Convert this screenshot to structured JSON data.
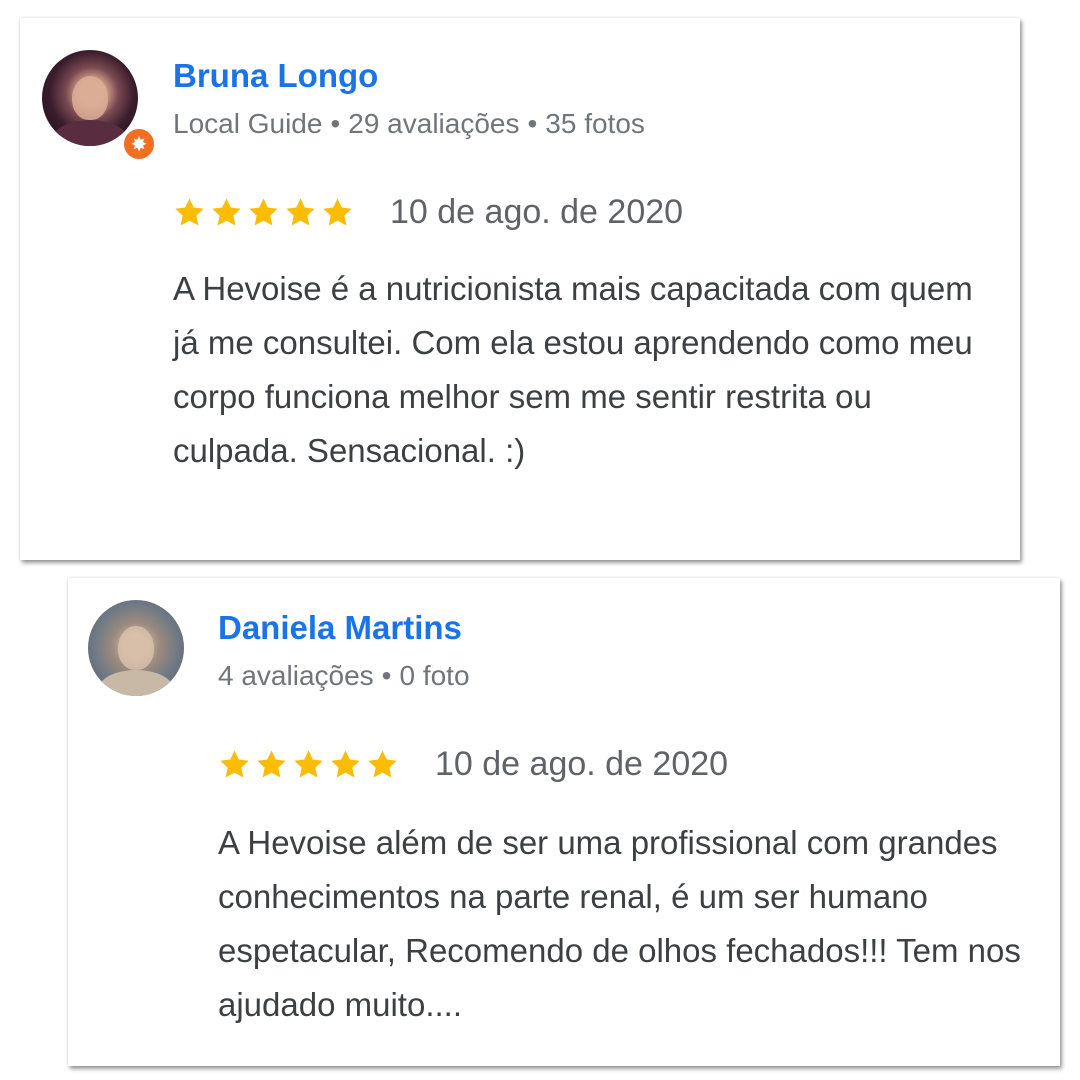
{
  "colors": {
    "name_blue": "#1a73e8",
    "meta_gray": "#70757a",
    "star_gold": "#fbbc04",
    "text_dark": "#3c4043",
    "badge_orange": "#f26f21"
  },
  "reviews": [
    {
      "name": "Bruna Longo",
      "meta": [
        "Local Guide",
        "29 avaliações",
        "35 fotos"
      ],
      "separator": "•",
      "badge_icon": "local-guide-star-icon",
      "rating": 5,
      "date": "10 de ago. de 2020",
      "text": "A Hevoise é a nutricionista mais capacitada com quem já me consultei. Com ela estou aprendendo como meu corpo funciona melhor sem me sentir restrita ou culpada. Sensacional. :)"
    },
    {
      "name": "Daniela Martins",
      "meta": [
        "4 avaliações",
        "0 foto"
      ],
      "separator": "•",
      "rating": 5,
      "date": "10 de ago. de 2020",
      "text": "A Hevoise além de ser uma profissional com grandes conhecimentos na parte renal, é um ser humano espetacular, Recomendo de olhos fechados!!! Tem nos ajudado muito...."
    }
  ]
}
